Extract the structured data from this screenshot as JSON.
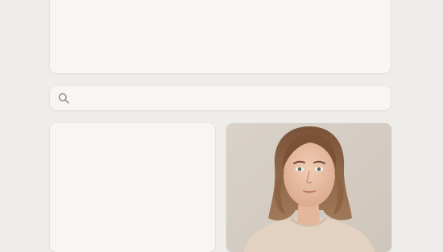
{
  "colors": {
    "page_bg": "#efedea",
    "card_bg": "#f8f6f3",
    "portrait_bg": "#dcd5cc"
  },
  "search": {
    "placeholder": "",
    "value": "",
    "icon": "search-icon"
  },
  "gallery": {
    "items": [
      {
        "kind": "empty"
      },
      {
        "kind": "photo",
        "subject": "portrait-photo"
      }
    ]
  }
}
